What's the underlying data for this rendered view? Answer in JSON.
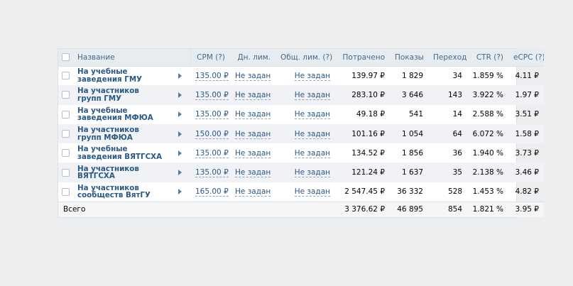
{
  "table": {
    "headers": {
      "name": "Название",
      "cpm": "CPM (?)",
      "day_limit": "Дн. лим.",
      "total_limit": "Общ. лим. (?)",
      "spent": "Потрачено",
      "impressions": "Показы",
      "clicks": "Переходы",
      "ctr": "CTR (?)",
      "ecpc": "eCPC (?)"
    },
    "rows": [
      {
        "name": "На учебные заведения ГМУ",
        "cpm": "135.00 ₽",
        "day_limit": "Не задан",
        "total_limit": "Не задан",
        "spent": "139.97 ₽",
        "impressions": "1 829",
        "clicks": "34",
        "ctr": "1.859 %",
        "ecpc": "4.11 ₽"
      },
      {
        "name": "На участников групп ГМУ",
        "cpm": "135.00 ₽",
        "day_limit": "Не задан",
        "total_limit": "Не задан",
        "spent": "283.10 ₽",
        "impressions": "3 646",
        "clicks": "143",
        "ctr": "3.922 %",
        "ecpc": "1.97 ₽"
      },
      {
        "name": "На учебные заведения МФЮА",
        "cpm": "135.00 ₽",
        "day_limit": "Не задан",
        "total_limit": "Не задан",
        "spent": "49.18 ₽",
        "impressions": "541",
        "clicks": "14",
        "ctr": "2.588 %",
        "ecpc": "3.51 ₽"
      },
      {
        "name": "На участников групп МФЮА",
        "cpm": "150.00 ₽",
        "day_limit": "Не задан",
        "total_limit": "Не задан",
        "spent": "101.16 ₽",
        "impressions": "1 054",
        "clicks": "64",
        "ctr": "6.072 %",
        "ecpc": "1.58 ₽"
      },
      {
        "name": "На учебные заведения ВЯТГСХА",
        "cpm": "135.00 ₽",
        "day_limit": "Не задан",
        "total_limit": "Не задан",
        "spent": "134.52 ₽",
        "impressions": "1 856",
        "clicks": "36",
        "ctr": "1.940 %",
        "ecpc": "3.73 ₽"
      },
      {
        "name": "На участников ВЯТГСХА",
        "cpm": "135.00 ₽",
        "day_limit": "Не задан",
        "total_limit": "Не задан",
        "spent": "121.24 ₽",
        "impressions": "1 637",
        "clicks": "35",
        "ctr": "2.138 %",
        "ecpc": "3.46 ₽"
      },
      {
        "name": "На участников сообществ ВятГУ",
        "cpm": "165.00 ₽",
        "day_limit": "Не задан",
        "total_limit": "Не задан",
        "spent": "2 547.45 ₽",
        "impressions": "36 332",
        "clicks": "528",
        "ctr": "1.453 %",
        "ecpc": "4.82 ₽"
      }
    ],
    "total": {
      "label": "Всего",
      "spent": "3 376.62 ₽",
      "impressions": "46 895",
      "clicks": "854",
      "ctr": "1.821 %",
      "ecpc": "3.95 ₽"
    }
  }
}
